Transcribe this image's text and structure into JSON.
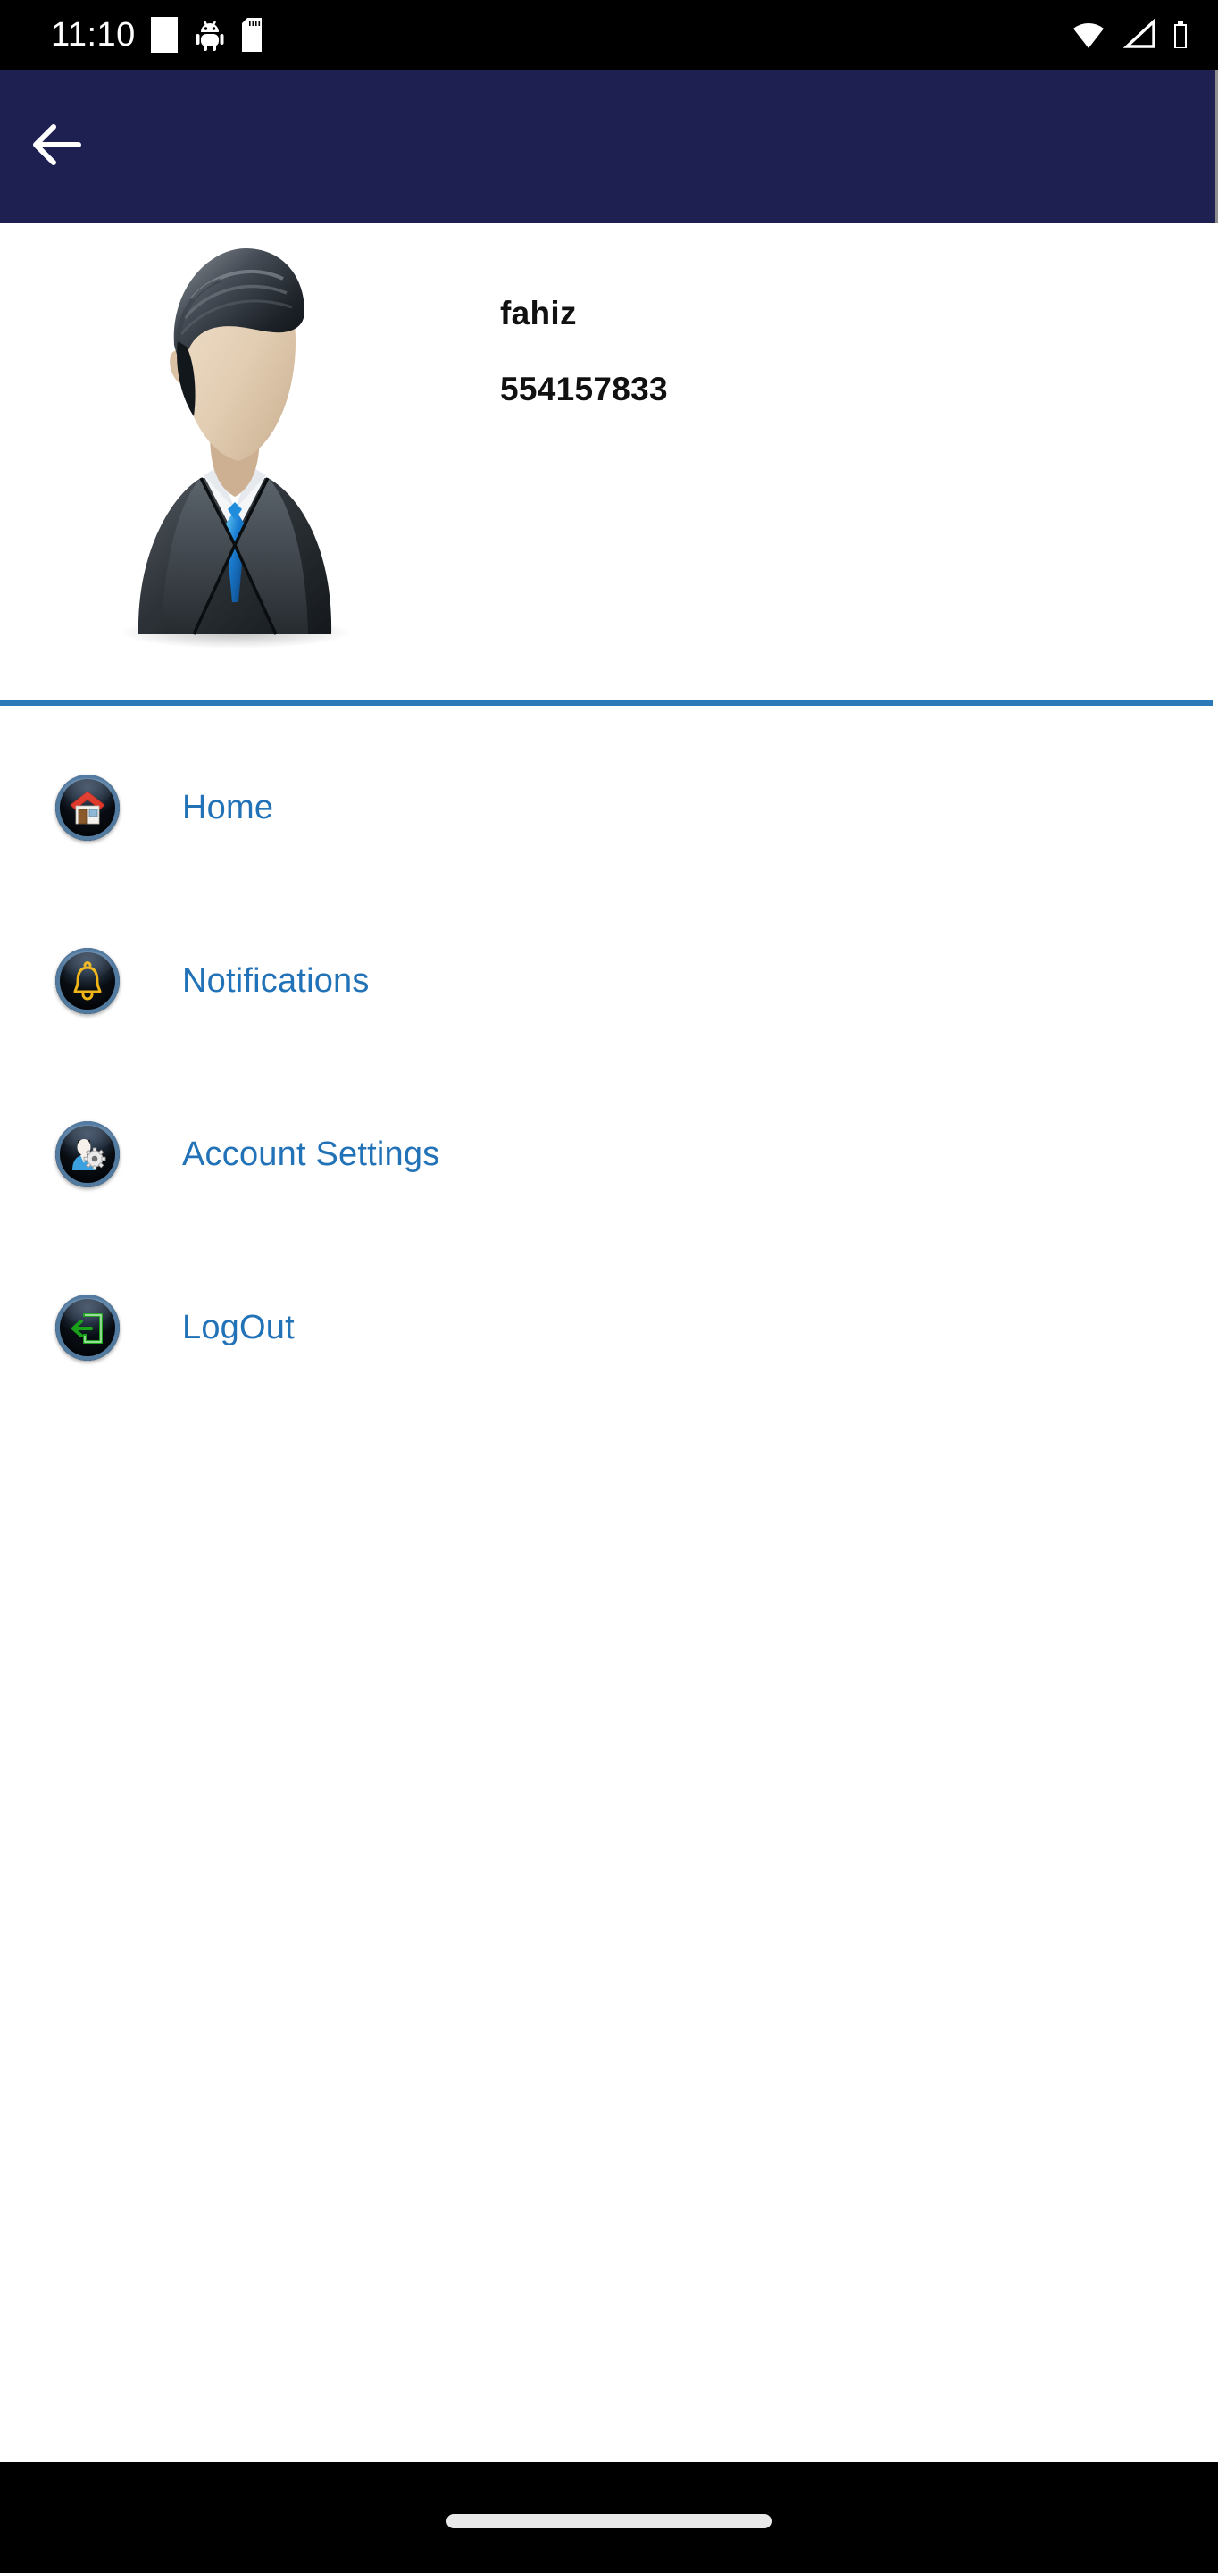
{
  "statusbar": {
    "time": "11:10",
    "icons_left": [
      "screenshot-square-icon",
      "android-bug-icon",
      "sd-card-icon"
    ],
    "icons_right": [
      "wifi-icon",
      "cellular-signal-icon",
      "battery-icon"
    ]
  },
  "appbar": {
    "title": "",
    "back_icon": "back-arrow-icon",
    "background_color": "#1d2050"
  },
  "profile": {
    "avatar_icon": "user-avatar-businessman",
    "username": "fahiz",
    "phone": "554157833"
  },
  "divider": {
    "color": "#2b79b8"
  },
  "menu": {
    "items": [
      {
        "label": "Home",
        "icon": "home-icon"
      },
      {
        "label": "Notifications",
        "icon": "bell-icon"
      },
      {
        "label": "Account Settings",
        "icon": "user-gear-icon"
      },
      {
        "label": "LogOut",
        "icon": "logout-icon"
      }
    ],
    "label_color": "#2272b8"
  },
  "navbar": {
    "handle": "gesture-pill-handle"
  }
}
